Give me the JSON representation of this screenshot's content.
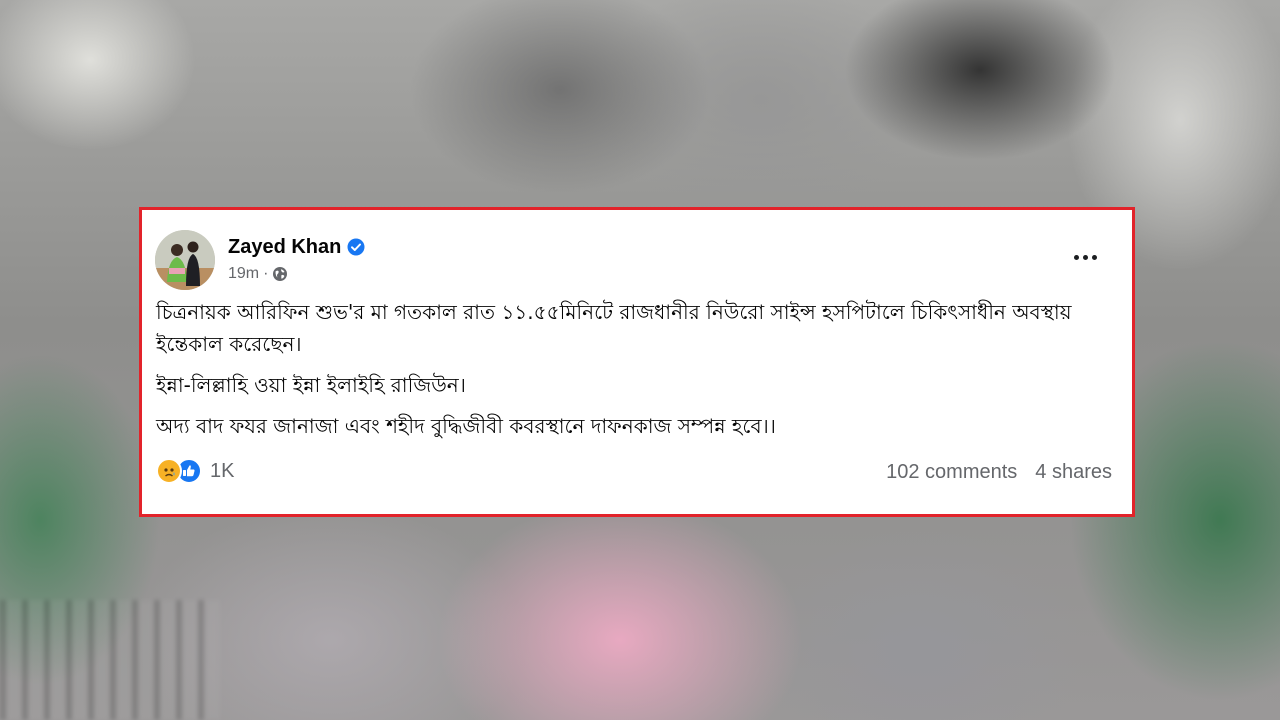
{
  "post": {
    "author": "Zayed Khan",
    "verified": true,
    "time": "19m",
    "audience_icon": "globe-icon",
    "menu_icon": "more-options-icon",
    "paragraphs": [
      "চিত্রনায়ক আরিফিন শুভ'র মা গতকাল রাত ১১.৫৫মিনিটে রাজধানীর নিউরো সাইন্স হসপিটালে চিকিৎসাধীন অবস্থায় ইন্তেকাল করেছেন।",
      "ইন্না-লিল্লাহি ওয়া ইন্না ইলাইহি রাজিউন।",
      "অদ্য বাদ ফযর জানাজা এবং শহীদ বুদ্ধিজীবী কবরস্থানে দাফনকাজ সম্পন্ন হবে।।"
    ],
    "reactions": {
      "icons": [
        "sad-reaction-icon",
        "like-reaction-icon"
      ],
      "count": "1K"
    },
    "comments": "102 comments",
    "shares": "4 shares"
  },
  "colors": {
    "highlight_border": "#e2232a",
    "verified_badge": "#1877f2",
    "like": "#1877f2",
    "sad": "#f7b125",
    "secondary_text": "#65676b"
  }
}
